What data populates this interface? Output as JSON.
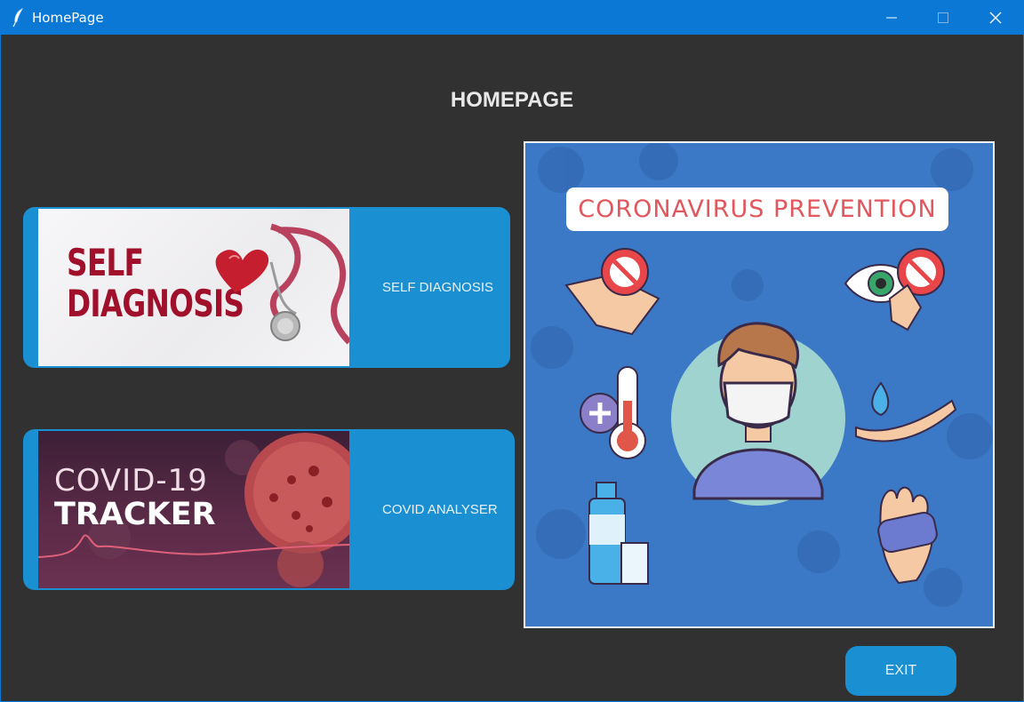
{
  "window": {
    "title": "HomePage"
  },
  "heading": "HOMEPAGE",
  "cards": {
    "self_diagnosis": {
      "image_text": [
        "SELF",
        "DIAGNOSIS"
      ],
      "label": "SELF DIAGNOSIS"
    },
    "covid": {
      "image_text": [
        "COVID-19",
        "TRACKER"
      ],
      "label": "COVID ANALYSER"
    }
  },
  "poster": {
    "banner": "CORONAVIRUS PREVENTION"
  },
  "exit_label": "EXIT",
  "colors": {
    "titlebar": "#0a78d4",
    "background": "#313131",
    "button": "#1a8fd1",
    "poster_bg": "#3b78c6",
    "banner_text": "#e0575e"
  }
}
